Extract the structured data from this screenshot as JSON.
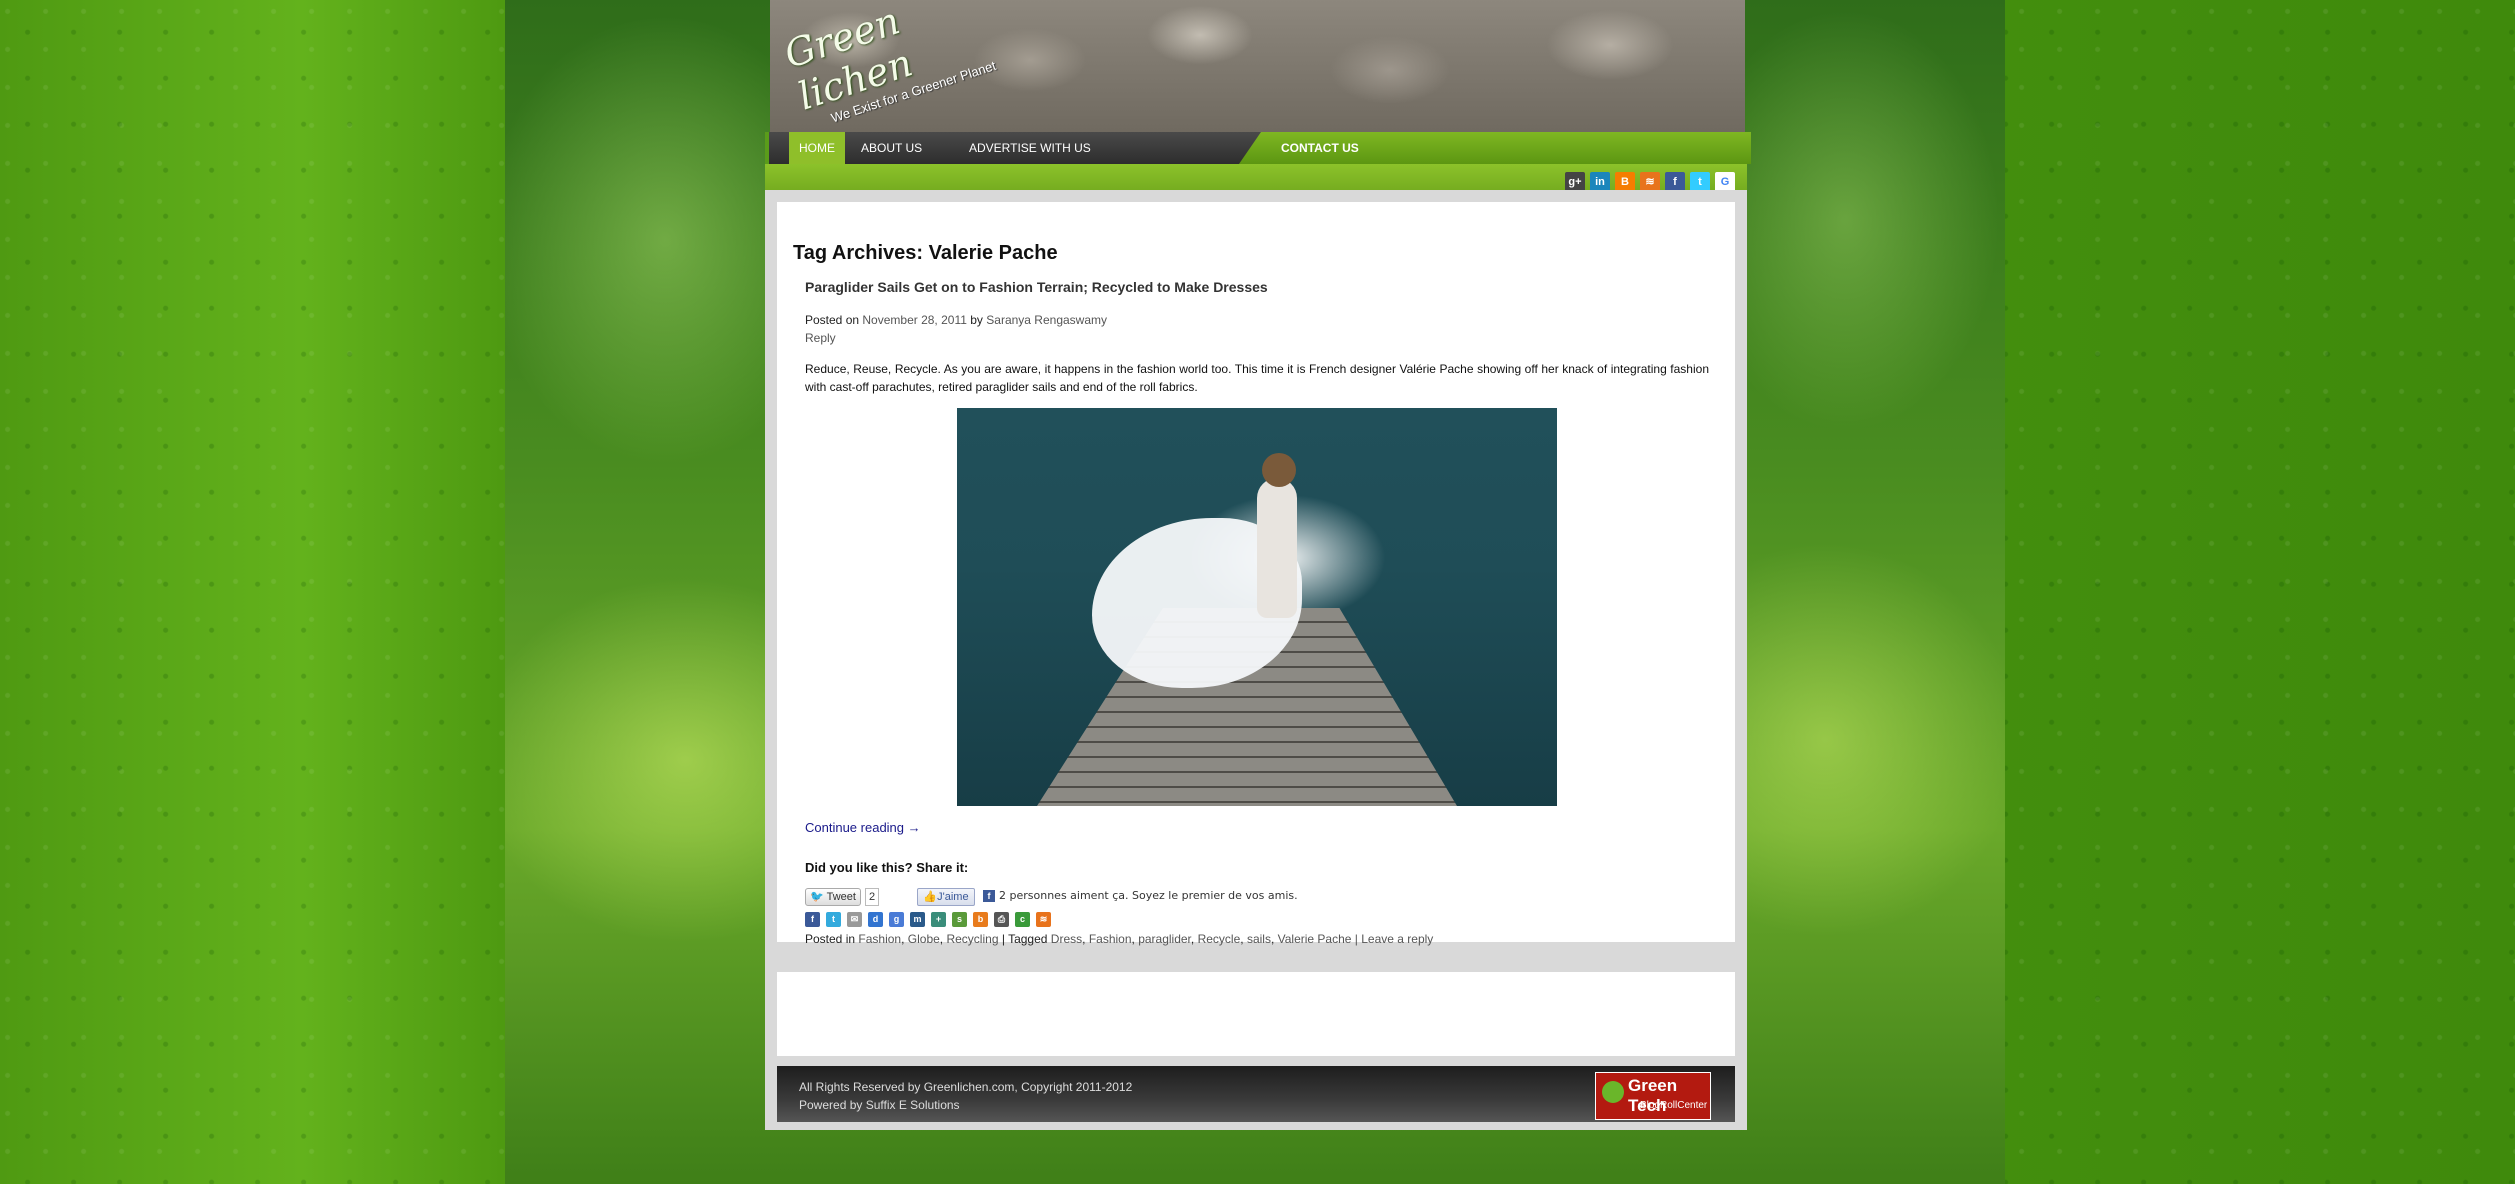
{
  "header": {
    "logo_name": "Green lichen",
    "logo_tagline": "We Exist for a Greener Planet"
  },
  "nav": {
    "items": [
      {
        "label": "HOME"
      },
      {
        "label": "ABOUT US"
      },
      {
        "label": "ADVERTISE WITH US"
      }
    ],
    "contact": "CONTACT US",
    "search_placeholder": "",
    "search_icon": "search-icon"
  },
  "social": [
    {
      "icon": "google-plus-icon",
      "glyph": "g+",
      "color": "#444444"
    },
    {
      "icon": "linkedin-icon",
      "glyph": "in",
      "color": "#1b86bc"
    },
    {
      "icon": "blogger-icon",
      "glyph": "B",
      "color": "#f57d00"
    },
    {
      "icon": "rss-icon",
      "glyph": "≋",
      "color": "#e8731c"
    },
    {
      "icon": "facebook-icon",
      "glyph": "f",
      "color": "#3b5998"
    },
    {
      "icon": "twitter-icon",
      "glyph": "t",
      "color": "#33ccff"
    },
    {
      "icon": "google-icon",
      "glyph": "G",
      "color": "#ffffff"
    }
  ],
  "post": {
    "archive_title": "Tag Archives: Valerie Pache",
    "title": "Paraglider Sails Get on to Fashion Terrain; Recycled to Make Dresses",
    "posted_on": "Posted on",
    "date": "November 28, 2011",
    "by": "by",
    "author": "Saranya Rengaswamy",
    "reply": "Reply",
    "excerpt": "Reduce, Reuse, Recycle. As you are aware, it happens in the fashion world too. This time it is French designer Valérie Pache showing off her knack of integrating fashion with cast-off parachutes, retired paraglider sails and end of the roll fabrics.",
    "continue": "Continue reading →",
    "share_title": "Did you like this? Share it:",
    "tweet_label": "Tweet",
    "tweet_count": "2",
    "like_label": "J'aime",
    "like_text": "2 personnes aiment ça. Soyez le premier de vos amis.",
    "share_icons": [
      {
        "icon": "facebook-share-icon",
        "glyph": "f",
        "color": "#3b5998"
      },
      {
        "icon": "twitter-share-icon",
        "glyph": "t",
        "color": "#33aadd"
      },
      {
        "icon": "email-share-icon",
        "glyph": "✉",
        "color": "#999999"
      },
      {
        "icon": "delicious-share-icon",
        "glyph": "d",
        "color": "#3274d0"
      },
      {
        "icon": "google-share-icon",
        "glyph": "g",
        "color": "#4a7bd6"
      },
      {
        "icon": "myspace-share-icon",
        "glyph": "m",
        "color": "#2a5a8a"
      },
      {
        "icon": "share-share-icon",
        "glyph": "+",
        "color": "#3a8d7a"
      },
      {
        "icon": "stumble-share-icon",
        "glyph": "s",
        "color": "#5a9a3a"
      },
      {
        "icon": "blogger-share-icon",
        "glyph": "b",
        "color": "#e87b1c"
      },
      {
        "icon": "print-share-icon",
        "glyph": "⎙",
        "color": "#555555"
      },
      {
        "icon": "technorati-share-icon",
        "glyph": "c",
        "color": "#3a9a3a"
      },
      {
        "icon": "rss-share-icon",
        "glyph": "≋",
        "color": "#e8731c"
      }
    ],
    "posted_in": "Posted in",
    "categories": [
      "Fashion",
      "Globe",
      "Recycling"
    ],
    "tagged": "| Tagged",
    "tags": [
      "Dress",
      "Fashion",
      "paraglider",
      "Recycle",
      "sails",
      "Valerie Pache"
    ],
    "leave_reply": "| Leave a reply"
  },
  "footer": {
    "copyright": "All Rights Reserved by Greenlichen.com, Copyright 2011-2012",
    "powered": "Powered by Suffix E Solutions",
    "badge_line1": "Green Tech",
    "badge_line2": "BlogRollCenter"
  }
}
